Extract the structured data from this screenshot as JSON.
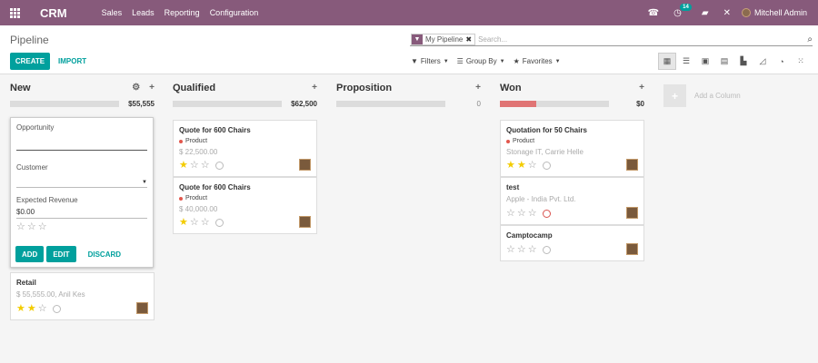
{
  "navbar": {
    "brand": "CRM",
    "menu": [
      "Sales",
      "Leads",
      "Reporting",
      "Configuration"
    ],
    "icons": [
      "apps-icon",
      "phone-icon",
      "activity-icon",
      "chat-icon",
      "close-icon"
    ],
    "activity_count": "14",
    "user": "Mitchell Admin"
  },
  "control": {
    "title": "Pipeline",
    "create_label": "CREATE",
    "import_label": "IMPORT",
    "facet_label": "My Pipeline",
    "search_placeholder": "Search...",
    "filters_label": "Filters",
    "groupby_label": "Group By",
    "favorites_label": "Favorites",
    "views": [
      "kanban",
      "list",
      "calendar",
      "pivot",
      "graph",
      "cohort",
      "dashboard",
      "activity"
    ]
  },
  "columns": [
    {
      "name": "New",
      "total": "$55,555",
      "progress": 0,
      "muted": false
    },
    {
      "name": "Qualified",
      "total": "$62,500",
      "progress": 0,
      "muted": false
    },
    {
      "name": "Proposition",
      "total": "0",
      "progress": 0,
      "muted": true
    },
    {
      "name": "Won",
      "total": "$0",
      "progress": 0.33,
      "muted": false
    }
  ],
  "quick_create": {
    "opportunity_label": "Opportunity",
    "opportunity_value": "",
    "customer_label": "Customer",
    "customer_value": "",
    "revenue_label": "Expected Revenue",
    "revenue_value": "$0.00",
    "add_label": "ADD",
    "edit_label": "EDIT",
    "discard_label": "DISCARD"
  },
  "cards": {
    "new": [
      {
        "title": "Retail",
        "tag": "",
        "amount": "$ 55,555.00, Anil Kes",
        "stars": 2
      }
    ],
    "qualified": [
      {
        "title": "Quote for 600 Chairs",
        "tag": "Product",
        "amount": "$ 22,500.00",
        "stars": 1
      },
      {
        "title": "Quote for 600 Chairs",
        "tag": "Product",
        "amount": "$ 40,000.00",
        "stars": 1
      }
    ],
    "won": [
      {
        "title": "Quotation for 50 Chairs",
        "tag": "Product",
        "amount": "Stonage IT, Carrie Helle",
        "stars": 2
      },
      {
        "title": "test",
        "tag": "",
        "amount": "Apple - India Pvt. Ltd.",
        "stars": 0
      },
      {
        "title": "Camptocamp",
        "tag": "",
        "amount": "",
        "stars": 0
      }
    ]
  },
  "add_column_label": "Add a Column"
}
